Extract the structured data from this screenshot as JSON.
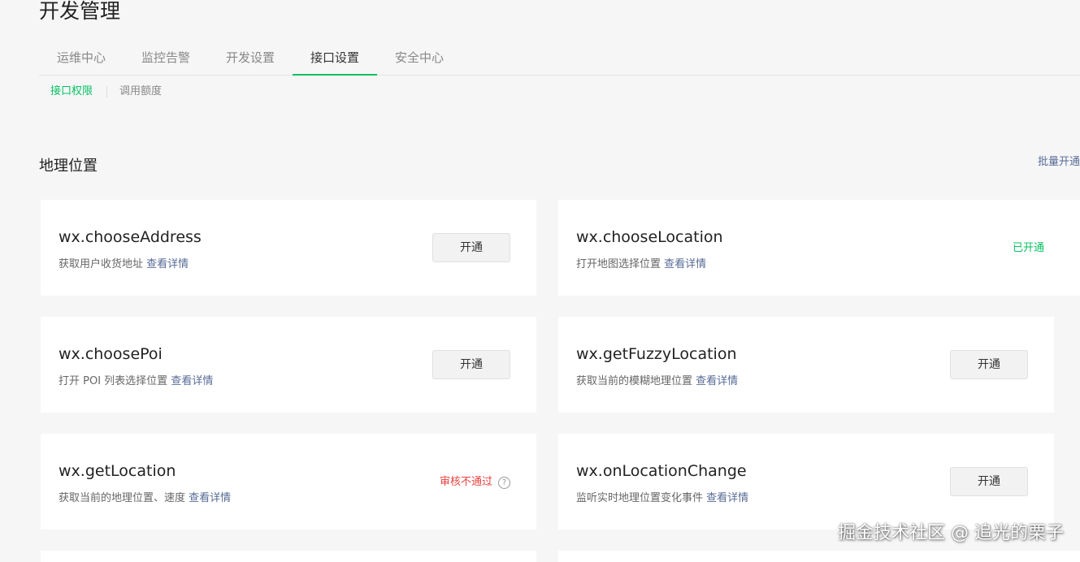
{
  "page": {
    "title": "开发管理"
  },
  "tabs": [
    {
      "label": "运维中心",
      "active": false
    },
    {
      "label": "监控告警",
      "active": false
    },
    {
      "label": "开发设置",
      "active": false
    },
    {
      "label": "接口设置",
      "active": true
    },
    {
      "label": "安全中心",
      "active": false
    }
  ],
  "subnav": {
    "active": "接口权限",
    "other": "调用额度"
  },
  "section": {
    "title": "地理位置",
    "batch_label": "批量开通"
  },
  "cards": [
    {
      "name": "wx.chooseAddress",
      "desc": "获取用户收货地址",
      "link": "查看详情",
      "action": "开通"
    },
    {
      "name": "wx.chooseLocation",
      "desc": "打开地图选择位置",
      "link": "查看详情",
      "status": "已开通"
    },
    {
      "name": "wx.choosePoi",
      "desc": "打开 POI 列表选择位置",
      "link": "查看详情",
      "action": "开通"
    },
    {
      "name": "wx.getFuzzyLocation",
      "desc": "获取当前的模糊地理位置",
      "link": "查看详情",
      "action": "开通"
    },
    {
      "name": "wx.getLocation",
      "desc": "获取当前的地理位置、速度",
      "link": "查看详情",
      "status": "审核不通过",
      "help_icon": "?"
    },
    {
      "name": "wx.onLocationChange",
      "desc": "监听实时地理位置变化事件",
      "link": "查看详情",
      "action": "开通"
    }
  ],
  "watermark": "掘金技术社区 @ 追光的栗子",
  "colors": {
    "accent": "#07c160",
    "link": "#576b95",
    "error": "#e64340",
    "background": "#f6f6f7"
  }
}
